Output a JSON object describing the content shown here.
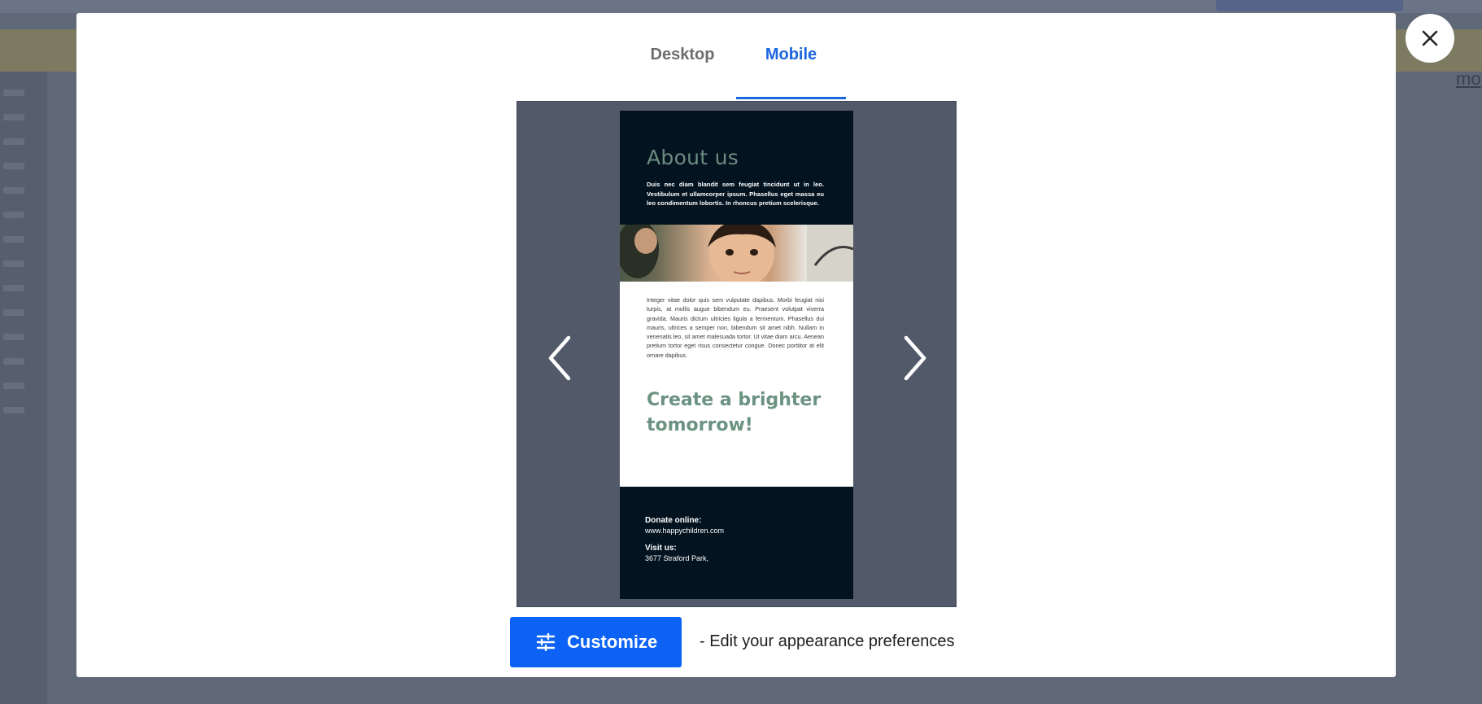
{
  "background": {
    "banner_link": "mo"
  },
  "modal": {
    "tabs": [
      {
        "label": "Desktop",
        "active": false
      },
      {
        "label": "Mobile",
        "active": true
      }
    ],
    "close_icon": "close-icon",
    "preview": {
      "prev_icon": "chevron-left-icon",
      "next_icon": "chevron-right-icon",
      "email": {
        "about_title": "About us",
        "about_text": "Duis nec diam blandit sem feugiat tincidunt ut in leo. Vestibulum et ullamcorper ipsum. Phasellus eget massa eu leo condimentum lobortis. In rhoncus pretium scelerisque.",
        "body_text": "Integer vitae dolor quis sem vulputate dapibus. Morbi feugiat nisi turpis, at mollis augue bibendum eu. Praesent volutpat viverra gravida. Mauris dictum ultricies ligula a fermentum. Phasellus dui mauris, ultrices a semper non, bibendum sit amet nibh. Nullam in venenatis leo, sit amet malesuada tortor. Ut vitae diam arcu. Aenean pretium tortor eget risus consectetur congue. Donec porttitor at elit ornare dapibus.",
        "cta": "Create a brighter tomorrow!",
        "donate_label": "Donate online:",
        "donate_url": "www.happychildren.com",
        "visit_label": "Visit us:",
        "visit_address": "3677 Straford Park,"
      }
    },
    "customize": {
      "label": "Customize",
      "icon": "sliders-icon",
      "hint": "- Edit your appearance preferences"
    }
  },
  "colors": {
    "accent": "#1a66e0",
    "button": "#0b62f5",
    "email_dark": "#031320",
    "email_green": "#6c9382"
  }
}
